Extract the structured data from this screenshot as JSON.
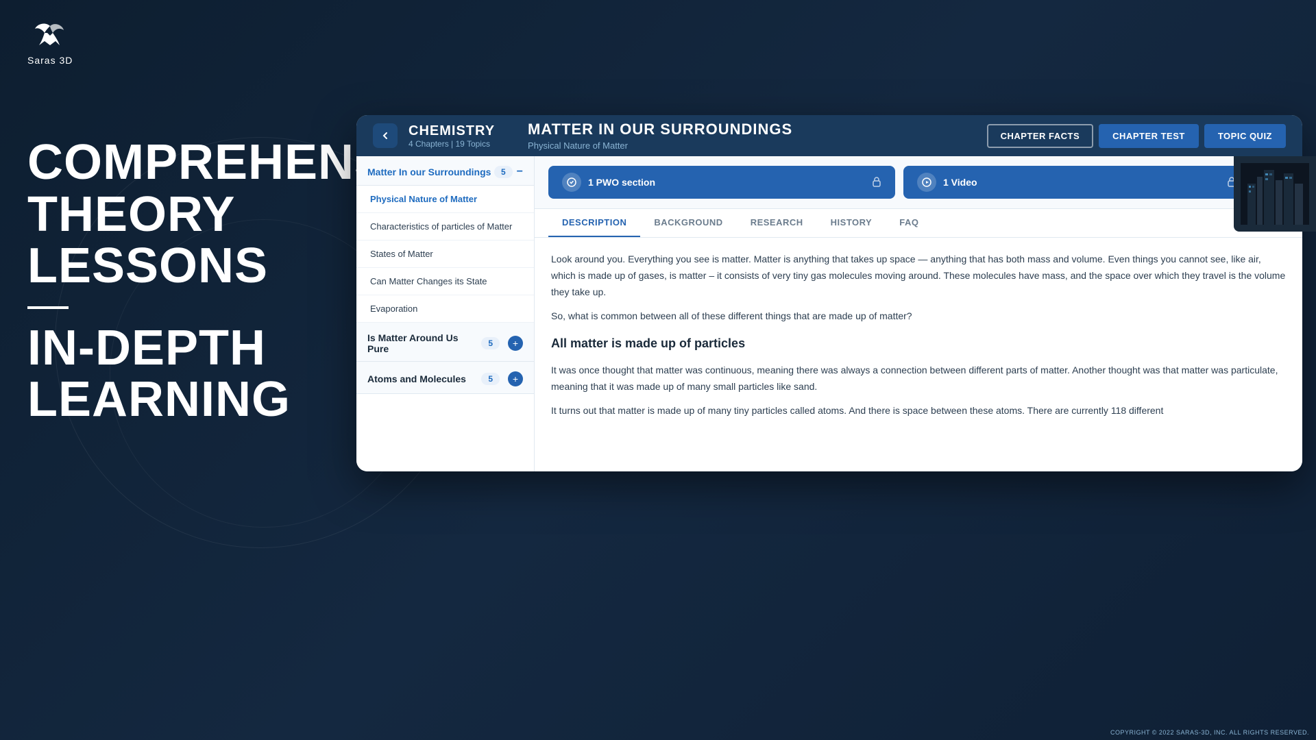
{
  "brand": {
    "name": "Saras 3D"
  },
  "left": {
    "line1": "COMPREHENSIVE",
    "line2": "THEORY LESSONS",
    "line3": "IN-DEPTH",
    "line4": "LEARNING"
  },
  "header": {
    "subject_name": "CHEMISTRY",
    "subject_meta": "4 Chapters | 19 Topics",
    "chapter_title": "MATTER IN OUR SURROUNDINGS",
    "chapter_subtitle": "Physical Nature of Matter",
    "btn_facts": "CHAPTER FACTS",
    "btn_test": "CHAPTER TEST",
    "btn_quiz": "TOPIC QUIZ"
  },
  "sidebar": {
    "chapter1_name": "Matter In our Surroundings",
    "chapter1_badge": "5",
    "topics": [
      {
        "label": "Physical Nature of Matter",
        "active": true
      },
      {
        "label": "Characteristics of particles of Matter"
      },
      {
        "label": "States of Matter"
      },
      {
        "label": "Can Matter Changes its State"
      },
      {
        "label": "Evaporation"
      }
    ],
    "chapter2_name": "Is Matter Around Us Pure",
    "chapter2_badge": "5",
    "chapter3_name": "Atoms and Molecules",
    "chapter3_badge": "5"
  },
  "resources": {
    "pwo_label": "1  PWO section",
    "video_label": "1  Video"
  },
  "tabs": [
    {
      "label": "DESCRIPTION",
      "active": true
    },
    {
      "label": "BACKGROUND"
    },
    {
      "label": "RESEARCH"
    },
    {
      "label": "HISTORY"
    },
    {
      "label": "FAQ"
    }
  ],
  "content": {
    "paragraph1": "Look around you. Everything you see is matter. Matter is anything that takes up space — anything that has both mass and volume. Even things you cannot see, like air, which is made up of gases, is matter – it consists of very tiny gas molecules moving around. These molecules have mass, and the space over which they travel is the volume they take up.",
    "paragraph2": "So, what is common between all of these different things that are made up of matter?",
    "heading": "All matter is made up of particles",
    "paragraph3": "It was once thought that matter was continuous, meaning there was always a connection between different parts of matter. Another thought was that matter was particulate, meaning that it was made up of many small particles like sand.",
    "paragraph4": "It turns out that matter is made up of many tiny particles called atoms. And there is space between these atoms. There are currently 118 different",
    "copyright": "COPYRIGHT © 2022 SARAS-3D, INC. ALL RIGHTS RESERVED."
  }
}
